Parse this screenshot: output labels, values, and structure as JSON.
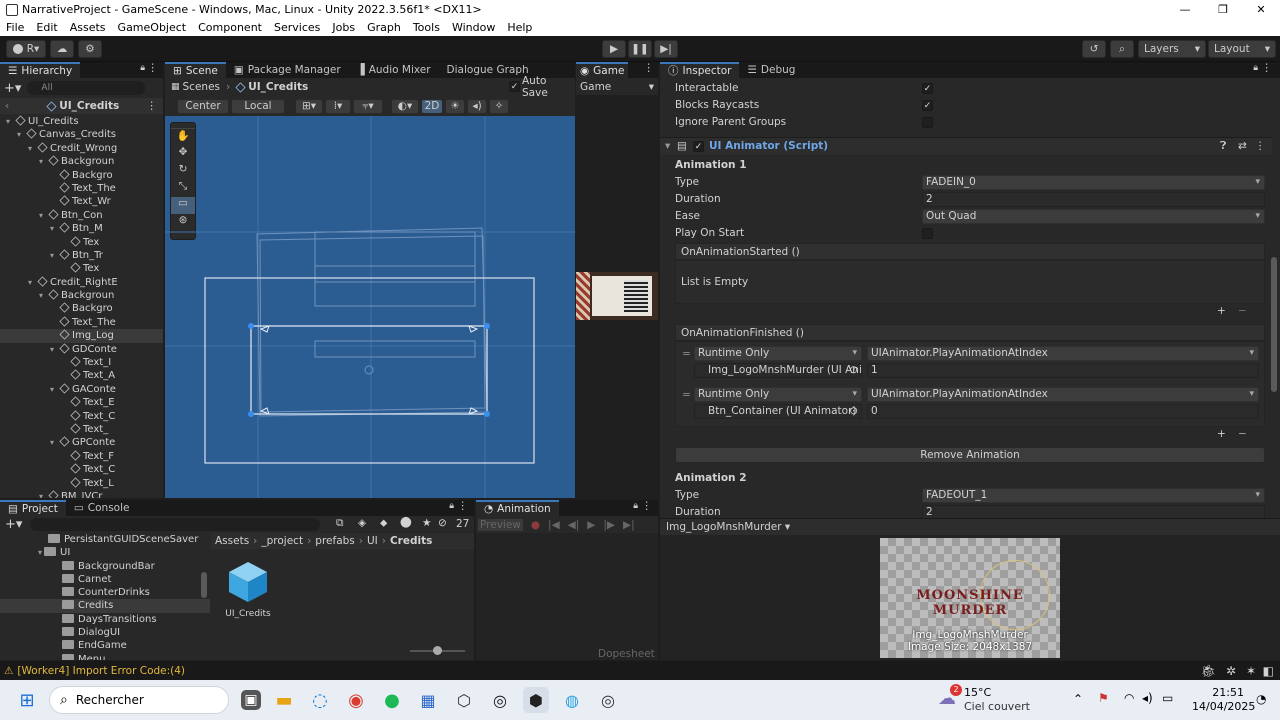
{
  "window": {
    "title": "NarrativeProject - GameScene - Windows, Mac, Linux - Unity 2022.3.56f1* <DX11>"
  },
  "menu": [
    "File",
    "Edit",
    "Assets",
    "GameObject",
    "Component",
    "Services",
    "Jobs",
    "Graph",
    "Tools",
    "Window",
    "Help"
  ],
  "toolbar": {
    "account_initial": "R",
    "layers_label": "Layers",
    "layout_label": "Layout"
  },
  "hierarchy": {
    "tab": "Hierarchy",
    "search_placeholder": "All",
    "scene_root": "UI_Credits",
    "items": [
      {
        "label": "UI_Credits",
        "depth": 1,
        "arrow": "▾"
      },
      {
        "label": "Canvas_Credits",
        "depth": 2,
        "arrow": "▾"
      },
      {
        "label": "Credit_Wrong",
        "depth": 3,
        "arrow": "▾"
      },
      {
        "label": "Backgroun",
        "depth": 4,
        "arrow": "▾"
      },
      {
        "label": "Backgro",
        "depth": 5,
        "arrow": ""
      },
      {
        "label": "Text_The",
        "depth": 5,
        "arrow": ""
      },
      {
        "label": "Text_Wr",
        "depth": 5,
        "arrow": ""
      },
      {
        "label": "Btn_Con",
        "depth": 4,
        "arrow": "▾"
      },
      {
        "label": "Btn_M",
        "depth": 5,
        "arrow": "▾"
      },
      {
        "label": "Tex",
        "depth": 6,
        "arrow": ""
      },
      {
        "label": "Btn_Tr",
        "depth": 5,
        "arrow": "▾"
      },
      {
        "label": "Tex",
        "depth": 6,
        "arrow": ""
      },
      {
        "label": "Credit_RightE",
        "depth": 3,
        "arrow": "▾"
      },
      {
        "label": "Backgroun",
        "depth": 4,
        "arrow": "▾"
      },
      {
        "label": "Backgro",
        "depth": 5,
        "arrow": ""
      },
      {
        "label": "Text_The",
        "depth": 5,
        "arrow": ""
      },
      {
        "label": "Img_Log",
        "depth": 5,
        "arrow": "",
        "selected": true
      },
      {
        "label": "GDConte",
        "depth": 5,
        "arrow": "▾"
      },
      {
        "label": "Text_I",
        "depth": 6,
        "arrow": ""
      },
      {
        "label": "Text_A",
        "depth": 6,
        "arrow": ""
      },
      {
        "label": "GAConte",
        "depth": 5,
        "arrow": "▾"
      },
      {
        "label": "Text_E",
        "depth": 6,
        "arrow": ""
      },
      {
        "label": "Text_C",
        "depth": 6,
        "arrow": ""
      },
      {
        "label": "Text_",
        "depth": 6,
        "arrow": ""
      },
      {
        "label": "GPConte",
        "depth": 5,
        "arrow": "▾"
      },
      {
        "label": "Text_F",
        "depth": 6,
        "arrow": ""
      },
      {
        "label": "Text_C",
        "depth": 6,
        "arrow": ""
      },
      {
        "label": "Text_L",
        "depth": 6,
        "arrow": ""
      },
      {
        "label": "BM_IVCr",
        "depth": 4,
        "arrow": "▾"
      }
    ]
  },
  "scene": {
    "tabs": [
      "Scene",
      "Package Manager",
      "Audio Mixer",
      "Dialogue Graph"
    ],
    "breadcrumb_scenes": "Scenes",
    "breadcrumb_prefab": "UI_Credits",
    "auto_save": "Auto Save",
    "pivot": "Center",
    "space": "Local",
    "mode_2d": "2D"
  },
  "game": {
    "tab": "Game",
    "display": "Game"
  },
  "inspector": {
    "tabs": [
      "Inspector",
      "Debug"
    ],
    "interactable": "Interactable",
    "blocks_raycasts": "Blocks Raycasts",
    "ignore_parent_groups": "Ignore Parent Groups",
    "component_title": "UI Animator (Script)",
    "anim1": {
      "header": "Animation 1",
      "type_label": "Type",
      "type_value": "FADEIN_0",
      "duration_label": "Duration",
      "duration_value": "2",
      "ease_label": "Ease",
      "ease_value": "Out Quad",
      "play_label": "Play On Start"
    },
    "on_started": {
      "title": "OnAnimationStarted ()",
      "empty": "List is Empty"
    },
    "on_finished": {
      "title": "OnAnimationFinished ()",
      "entries": [
        {
          "mode": "Runtime Only",
          "function": "UIAnimator.PlayAnimationAtIndex",
          "object": "Img_LogoMnshMurder (UI Ani",
          "arg": "1"
        },
        {
          "mode": "Runtime Only",
          "function": "UIAnimator.PlayAnimationAtIndex",
          "object": "Btn_Container (UI Animator)",
          "arg": "0"
        }
      ]
    },
    "remove_button": "Remove Animation",
    "anim2": {
      "header": "Animation 2",
      "type_label": "Type",
      "type_value": "FADEOUT_1",
      "duration_label": "Duration",
      "duration_value": "2"
    },
    "preview": {
      "object": "Img_LogoMnshMurder",
      "logo_text": "MOONSHINE MURDER",
      "name": "Img_LogoMnshMurder",
      "size": "Image Size: 2048x1387"
    }
  },
  "project": {
    "tabs": [
      "Project",
      "Console"
    ],
    "count": "27",
    "tree": [
      {
        "label": "PersistantGUIDSceneSaver",
        "depth": 1
      },
      {
        "label": "UI",
        "depth": 1,
        "open": true
      },
      {
        "label": "BackgroundBar",
        "depth": 2
      },
      {
        "label": "Carnet",
        "depth": 2
      },
      {
        "label": "CounterDrinks",
        "depth": 2
      },
      {
        "label": "Credits",
        "depth": 2,
        "selected": true
      },
      {
        "label": "DaysTransitions",
        "depth": 2
      },
      {
        "label": "DialogUI",
        "depth": 2
      },
      {
        "label": "EndGame",
        "depth": 2
      },
      {
        "label": "Menu",
        "depth": 2
      }
    ],
    "breadcrumb": [
      "Assets",
      "_project",
      "prefabs",
      "UI",
      "Credits"
    ],
    "asset_name": "UI_Credits"
  },
  "animation": {
    "tab": "Animation",
    "preview": "Preview",
    "dopesheet": "Dopesheet"
  },
  "status": {
    "message": "[Worker4] Import Error Code:(4)"
  },
  "taskbar": {
    "search": "Rechercher",
    "weather_temp": "15°C",
    "weather_desc": "Ciel couvert",
    "time": "21:51",
    "date": "14/04/2025",
    "weather_badge": "2"
  },
  "colors": {
    "accent": "#3a79bb",
    "scene_bg": "#2c5d92",
    "selection": "#2c5d87"
  }
}
